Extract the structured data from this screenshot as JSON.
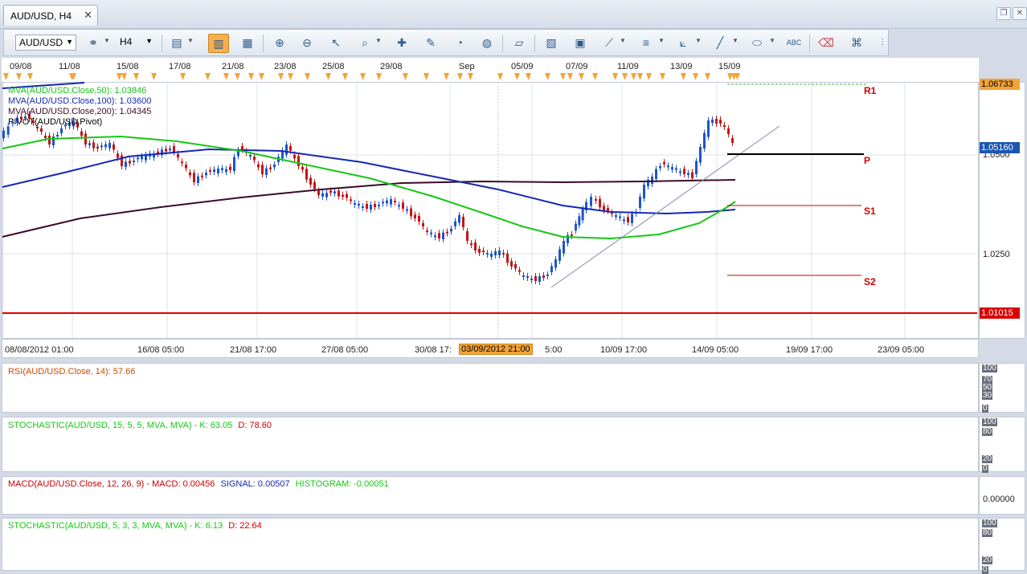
{
  "window": {
    "tab_title": "AUD/USD, H4",
    "close_symbol": "✕",
    "restore_symbol": "❐",
    "close_window_symbol": "✕"
  },
  "toolbar": {
    "symbol": "AUD/USD",
    "timeframe": "H4",
    "icons": [
      "link-icon",
      "bar-chart-icon",
      "candlestick-icon",
      "line-chart-icon",
      "zoom-in-icon",
      "zoom-out-icon",
      "cursor-icon",
      "zoom-box-icon",
      "crosshair-icon",
      "edit-icon",
      "indicator-icon",
      "globe-icon",
      "ruler-icon",
      "image-icon",
      "templates-icon",
      "draw-lines-icon",
      "channel-icon",
      "fibonacci-icon",
      "trendline-icon",
      "ellipse-icon",
      "text-icon",
      "eraser-icon",
      "objects-icon"
    ]
  },
  "dates_top": [
    "09/08",
    "11/08",
    "15/08",
    "17/08",
    "21/08",
    "23/08",
    "25/08",
    "29/08",
    "Sep",
    "05/09",
    "07/09",
    "11/09",
    "13/09",
    "15/09"
  ],
  "price_chart": {
    "legend": [
      {
        "text": "MVA(AUD/USD.Close,50): 1.03846",
        "color": "#14c814"
      },
      {
        "text": "MVA(AUD/USD.Close,100): 1.03600",
        "color": "#1428b4"
      },
      {
        "text": "MVA(AUD/USD.Close,200): 1.04345",
        "color": "#3c0a28"
      },
      {
        "text": "PIVOT(AUD/USD,Pivot)",
        "color": "#000000"
      }
    ],
    "price_axis": [
      "1.0500",
      "1.0250"
    ],
    "tags": [
      {
        "text": "1.06733",
        "bg": "#f3a437",
        "color": "#000"
      },
      {
        "text": "1.05160",
        "bg": "#1c56b0",
        "color": "#fff"
      },
      {
        "text": "1.01015",
        "bg": "#d80000",
        "color": "#fff"
      }
    ],
    "pivot_labels": {
      "r1": "R1",
      "p": "P",
      "s1": "S1",
      "s2": "S2"
    }
  },
  "time_axis": {
    "labels": [
      "08/08/2012 01:00",
      "16/08 05:00",
      "21/08 17:00",
      "27/08 05:00",
      "30/08 17:",
      "5:00",
      "10/09 17:00",
      "14/09 05:00",
      "19/09 17:00",
      "23/09 05:00"
    ],
    "cursor": "03/09/2012 21:00"
  },
  "indicators": {
    "rsi": {
      "legend": "RSI(AUD/USD.Close, 14): 57.66",
      "axis": [
        "100",
        "70",
        "50",
        "30",
        "0"
      ]
    },
    "stoch1": {
      "legend_a": "STOCHASTIC(AUD/USD, 15, 5, 5, MVA, MVA) -  K: 63.05",
      "legend_b": "D: 78.60",
      "axis": [
        "100",
        "80",
        "20",
        "0"
      ]
    },
    "macd": {
      "legend_a": "MACD(AUD/USD.Close, 12, 26, 9) -  MACD: 0.00456",
      "legend_b": "SIGNAL: 0.00507",
      "legend_c": "HISTOGRAM: -0.00051",
      "axis": [
        "0.00000"
      ]
    },
    "stoch2": {
      "legend_a": "STOCHASTIC(AUD/USD, 5, 3, 3, MVA, MVA) -  K: 6.13",
      "legend_b": "D: 22.64",
      "axis": [
        "100",
        "80",
        "20",
        "0"
      ]
    }
  },
  "colors": {
    "accent": "#f3a437",
    "pivot": "#d00000",
    "ma50": "#14c814",
    "ma100": "#1428b4",
    "ma200": "#3c0a28",
    "candle_up": "#1c56c8",
    "candle_down": "#c81414"
  }
}
